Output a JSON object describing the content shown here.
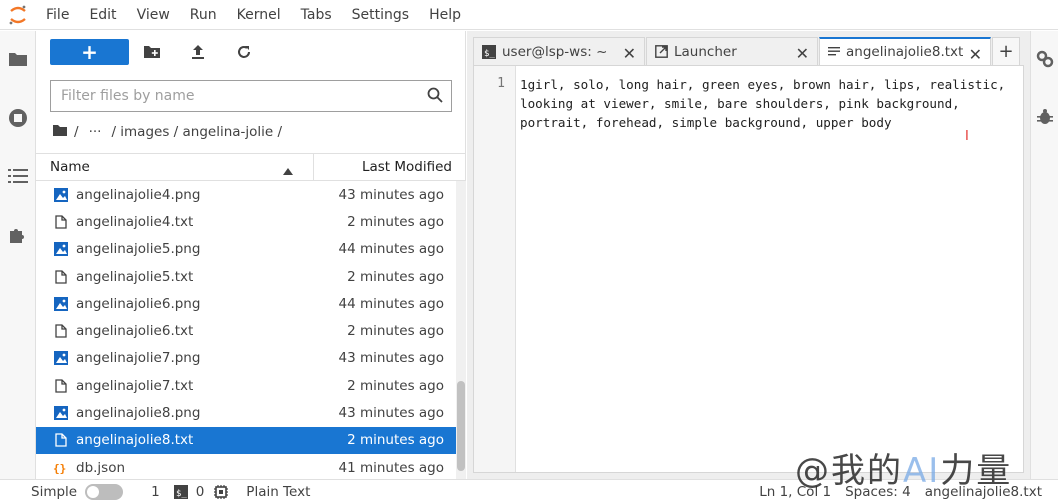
{
  "menubar": {
    "items": [
      "File",
      "Edit",
      "View",
      "Run",
      "Kernel",
      "Tabs",
      "Settings",
      "Help"
    ]
  },
  "filebrowser": {
    "new_label": "+",
    "search_placeholder": "Filter files by name",
    "breadcrumb": [
      "/",
      "···",
      "/ images / angelina-jolie /"
    ],
    "header": {
      "name": "Name",
      "modified": "Last Modified"
    },
    "files": [
      {
        "name": "angelinajolie4.png",
        "modified": "43 minutes ago",
        "type": "image"
      },
      {
        "name": "angelinajolie4.txt",
        "modified": "2 minutes ago",
        "type": "text"
      },
      {
        "name": "angelinajolie5.png",
        "modified": "44 minutes ago",
        "type": "image"
      },
      {
        "name": "angelinajolie5.txt",
        "modified": "2 minutes ago",
        "type": "text"
      },
      {
        "name": "angelinajolie6.png",
        "modified": "44 minutes ago",
        "type": "image"
      },
      {
        "name": "angelinajolie6.txt",
        "modified": "2 minutes ago",
        "type": "text"
      },
      {
        "name": "angelinajolie7.png",
        "modified": "43 minutes ago",
        "type": "image"
      },
      {
        "name": "angelinajolie7.txt",
        "modified": "2 minutes ago",
        "type": "text"
      },
      {
        "name": "angelinajolie8.png",
        "modified": "43 minutes ago",
        "type": "image"
      },
      {
        "name": "angelinajolie8.txt",
        "modified": "2 minutes ago",
        "type": "text",
        "selected": true
      },
      {
        "name": "db.json",
        "modified": "41 minutes ago",
        "type": "json"
      }
    ]
  },
  "tabs": [
    {
      "label": "user@lsp-ws: ~",
      "icon": "terminal-icon"
    },
    {
      "label": "Launcher",
      "icon": "launcher-icon"
    },
    {
      "label": "angelinajolie8.txt",
      "icon": "text-file-icon",
      "active": true
    }
  ],
  "editor": {
    "line_number": "1",
    "content": "1girl, solo, long hair, green eyes, brown hair, lips, realistic, looking at viewer, smile, bare shoulders, pink background, portrait, forehead, simple background, upper body"
  },
  "statusbar": {
    "mode": "Simple",
    "terminals": "1",
    "kernels": "0",
    "file_type": "Plain Text",
    "cursor": "Ln 1, Col 1",
    "spaces": "Spaces: 4",
    "filename": "angelinajolie8.txt"
  },
  "watermark": {
    "prefix": "@我的",
    "ai": "AI",
    "suffix": "力量"
  },
  "colors": {
    "accent": "#1976d2",
    "brand_orange": "#f37726"
  }
}
